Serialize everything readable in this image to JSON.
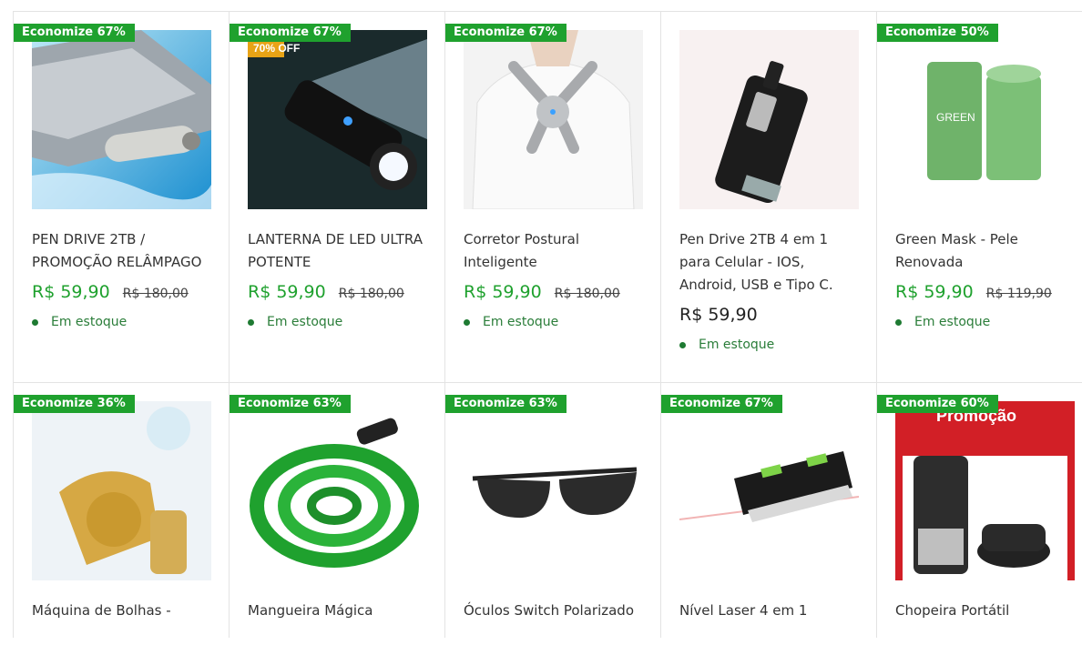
{
  "row1": [
    {
      "badge": "Economize 67%",
      "title": "PEN DRIVE 2TB / PROMOÇÃO RELÂMPAGO",
      "price": "R$ 59,90",
      "old": "R$ 180,00",
      "stock": "Em estoque"
    },
    {
      "badge": "Economize 67%",
      "title": "LANTERNA DE LED ULTRA POTENTE",
      "price": "R$ 59,90",
      "old": "R$ 180,00",
      "stock": "Em estoque",
      "img_text": "70% OFF"
    },
    {
      "badge": "Economize 67%",
      "title": "Corretor Postural Inteligente",
      "price": "R$ 59,90",
      "old": "R$ 180,00",
      "stock": "Em estoque"
    },
    {
      "title": "Pen Drive 2TB 4 em 1 para Celular - IOS, Android, USB e Tipo C.",
      "price": "R$ 59,90",
      "stock": "Em estoque"
    },
    {
      "badge": "Economize 50%",
      "title": "Green Mask - Pele Renovada",
      "price": "R$ 59,90",
      "old": "R$ 119,90",
      "stock": "Em estoque",
      "img_text": "GREEN"
    }
  ],
  "row2": [
    {
      "badge": "Economize 36%",
      "title": "Máquina de Bolhas -"
    },
    {
      "badge": "Economize 63%",
      "title": "Mangueira Mágica"
    },
    {
      "badge": "Economize 63%",
      "title": "Óculos Switch Polarizado"
    },
    {
      "badge": "Economize 67%",
      "title": "Nível Laser 4 em 1"
    },
    {
      "badge": "Economize 60%",
      "title": "Chopeira Portátil",
      "img_text": "Promoção"
    }
  ],
  "colors": {
    "accent": "#1fa12e",
    "stock": "#2a7d39",
    "border": "#e3e3e3"
  }
}
